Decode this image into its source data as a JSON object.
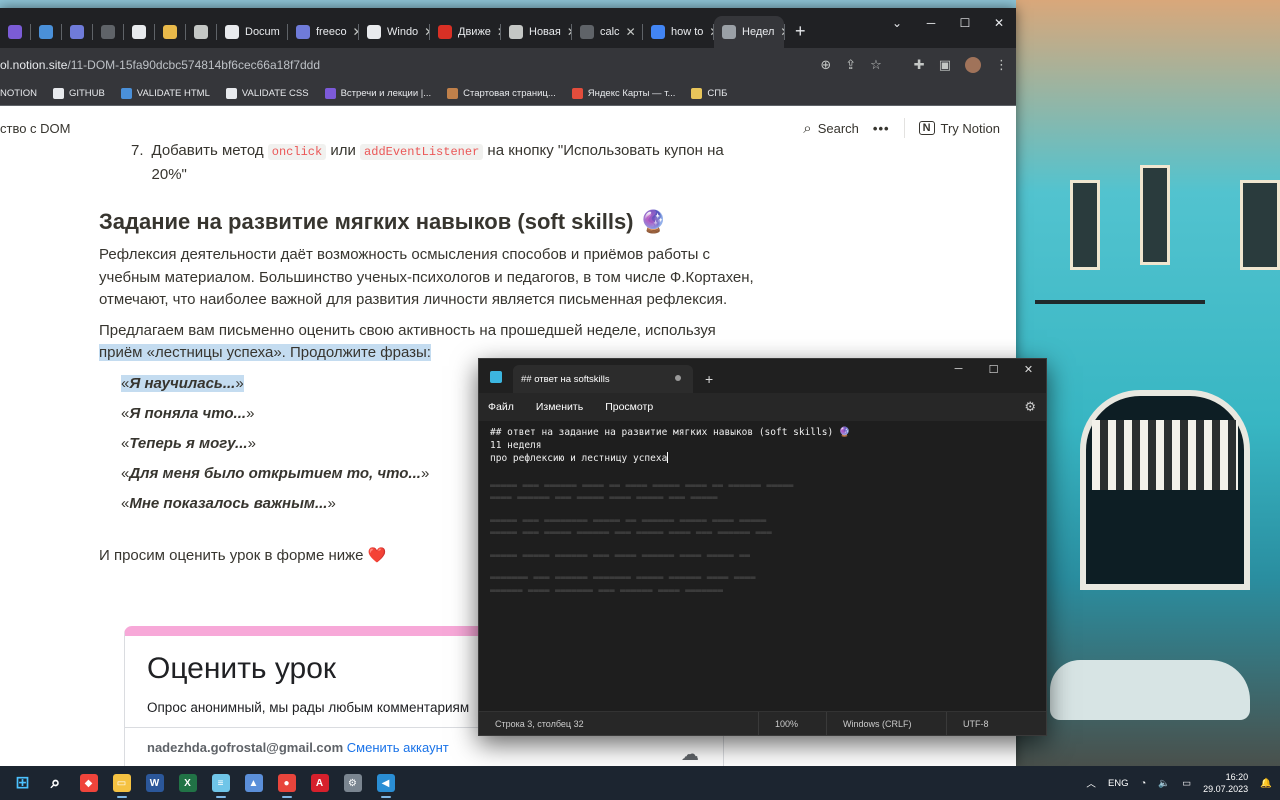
{
  "browser": {
    "tabs": [
      {
        "label": "",
        "color": "#7b5cd6"
      },
      {
        "label": "",
        "color": "#4a90d9"
      },
      {
        "label": "",
        "color": "#6f7bd9"
      },
      {
        "label": "",
        "color": "#5f6368"
      },
      {
        "label": "",
        "color": "#e8eaed"
      },
      {
        "label": "",
        "color": "#e8b94a"
      },
      {
        "label": "",
        "color": "#c4c7c5"
      },
      {
        "label": "Docum",
        "color": "#e8eaed"
      },
      {
        "label": "freeco",
        "color": "#6f7bd9"
      },
      {
        "label": "Windo",
        "color": "#e8eaed"
      },
      {
        "label": "Движе",
        "color": "#d93025"
      },
      {
        "label": "Новая",
        "color": "#c4c7c5"
      },
      {
        "label": "calc",
        "color": "#5f6368"
      },
      {
        "label": "how to",
        "color": "#4285f4"
      },
      {
        "label": "Недел",
        "color": "#9aa0a6"
      }
    ],
    "new_tab": "+",
    "url_domain": "ol.notion.site",
    "url_path": "/11-DOM-15fa90dcbc574814bf6cec66a18f7ddd",
    "bookmarks": [
      {
        "label": "NOTION",
        "color": "#e8eaed"
      },
      {
        "label": "GITHUB",
        "color": "#e8eaed"
      },
      {
        "label": "VALIDATE HTML",
        "color": "#4a90d9"
      },
      {
        "label": "VALIDATE CSS",
        "color": "#e8eaed"
      },
      {
        "label": "Встречи и лекции |...",
        "color": "#7c5ad9"
      },
      {
        "label": "Стартовая страниц...",
        "color": "#c0804a"
      },
      {
        "label": "Яндекс Карты — т...",
        "color": "#e34d3c"
      },
      {
        "label": "СПБ",
        "color": "#e8c55a"
      }
    ]
  },
  "notion": {
    "breadcrumb": "ство с DOM",
    "search_label": "Search",
    "more_label": "•••",
    "try_label": "Try Notion",
    "list_item_num": "7.",
    "list_item_prefix": "Добавить метод ",
    "code_onclick": "onclick",
    "list_item_or": " или ",
    "code_listener": "addEventListener",
    "list_item_suffix": " на кнопку \"Использовать купон на 20%\"",
    "heading": "Задание на развитие мягких навыков (soft skills) 🔮",
    "para1": "Рефлексия деятельности даёт возможность осмысления способов и приёмов работы с учебным материалом. Большинство ученых-психологов и педагогов, в том числе Ф.Кортахен, отмечают, что наиболее важной для развития личности является письменная рефлексия.",
    "para2_a": "Предлагаем вам письменно оценить свою активность на прошедшей неделе, используя ",
    "para2_b": "приём «лестницы успеха». Продолжите фразы:",
    "quotes": [
      "Я научилась...",
      "Я поняла что...",
      "Теперь я могу...",
      "Для меня было открытием то, что...",
      "Мне показалось важным..."
    ],
    "rate_text": "И просим оценить урок в форме ниже ",
    "heart": "❤️",
    "form_title": "Оценить урок",
    "form_sub": "Опрос анонимный, мы рады любым комментариям",
    "form_email": "nadezhda.gofrostal@gmail.com",
    "form_switch": "Сменить аккаунт"
  },
  "notepad": {
    "tab_title": "## ответ на softskills",
    "new_tab": "+",
    "menu": [
      "Файл",
      "Изменить",
      "Просмотр"
    ],
    "lines": [
      "## ответ на задание на развитие мягких навыков (soft skills) 🔮",
      "11 неделя",
      "про рефлексию и лестницу успеха"
    ],
    "status_position": "Строка 3, столбец 32",
    "status_zoom": "100%",
    "status_eol": "Windows (CRLF)",
    "status_encoding": "UTF-8"
  },
  "taskbar": {
    "apps": [
      {
        "name": "start",
        "color": "#4cc2ff",
        "glyph": "⊞"
      },
      {
        "name": "search",
        "color": "transparent",
        "glyph": "⌕"
      },
      {
        "name": "anydesk",
        "color": "#ef443b",
        "glyph": "◆"
      },
      {
        "name": "explorer",
        "color": "#f5c242",
        "glyph": "▭"
      },
      {
        "name": "word",
        "color": "#2b579a",
        "glyph": "W"
      },
      {
        "name": "excel",
        "color": "#217346",
        "glyph": "X"
      },
      {
        "name": "notepad",
        "color": "#6fc5e8",
        "glyph": "≡"
      },
      {
        "name": "photos",
        "color": "#5b8fd9",
        "glyph": "▲"
      },
      {
        "name": "chrome",
        "color": "#e8453c",
        "glyph": "●"
      },
      {
        "name": "acrobat",
        "color": "#d6202c",
        "glyph": "A"
      },
      {
        "name": "settings",
        "color": "#7a8590",
        "glyph": "⚙"
      },
      {
        "name": "vscode",
        "color": "#2a8ed4",
        "glyph": "◀"
      }
    ],
    "lang": "ENG",
    "time": "16:20",
    "date": "29.07.2023"
  }
}
